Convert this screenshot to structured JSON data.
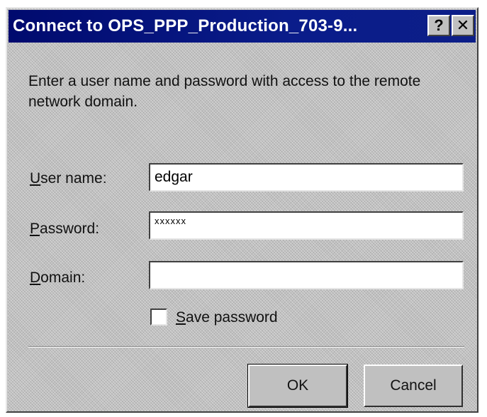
{
  "window": {
    "title": "Connect to OPS_PPP_Production_703-9...",
    "help_glyph": "?",
    "close_glyph": "✕"
  },
  "prompt": "Enter a user name and password with access to the remote network domain.",
  "fields": {
    "username": {
      "label_accel": "U",
      "label_rest": "ser name:",
      "value": "edgar"
    },
    "password": {
      "label_accel": "P",
      "label_rest": "assword:",
      "value": "xxxxxx"
    },
    "domain": {
      "label_accel": "D",
      "label_rest": "omain:",
      "value": ""
    }
  },
  "save_password": {
    "accel": "S",
    "rest": "ave password",
    "checked": false
  },
  "buttons": {
    "ok": "OK",
    "cancel": "Cancel"
  },
  "colors": {
    "titlebar": "#0a1c8a",
    "face": "#c0c0c0"
  }
}
